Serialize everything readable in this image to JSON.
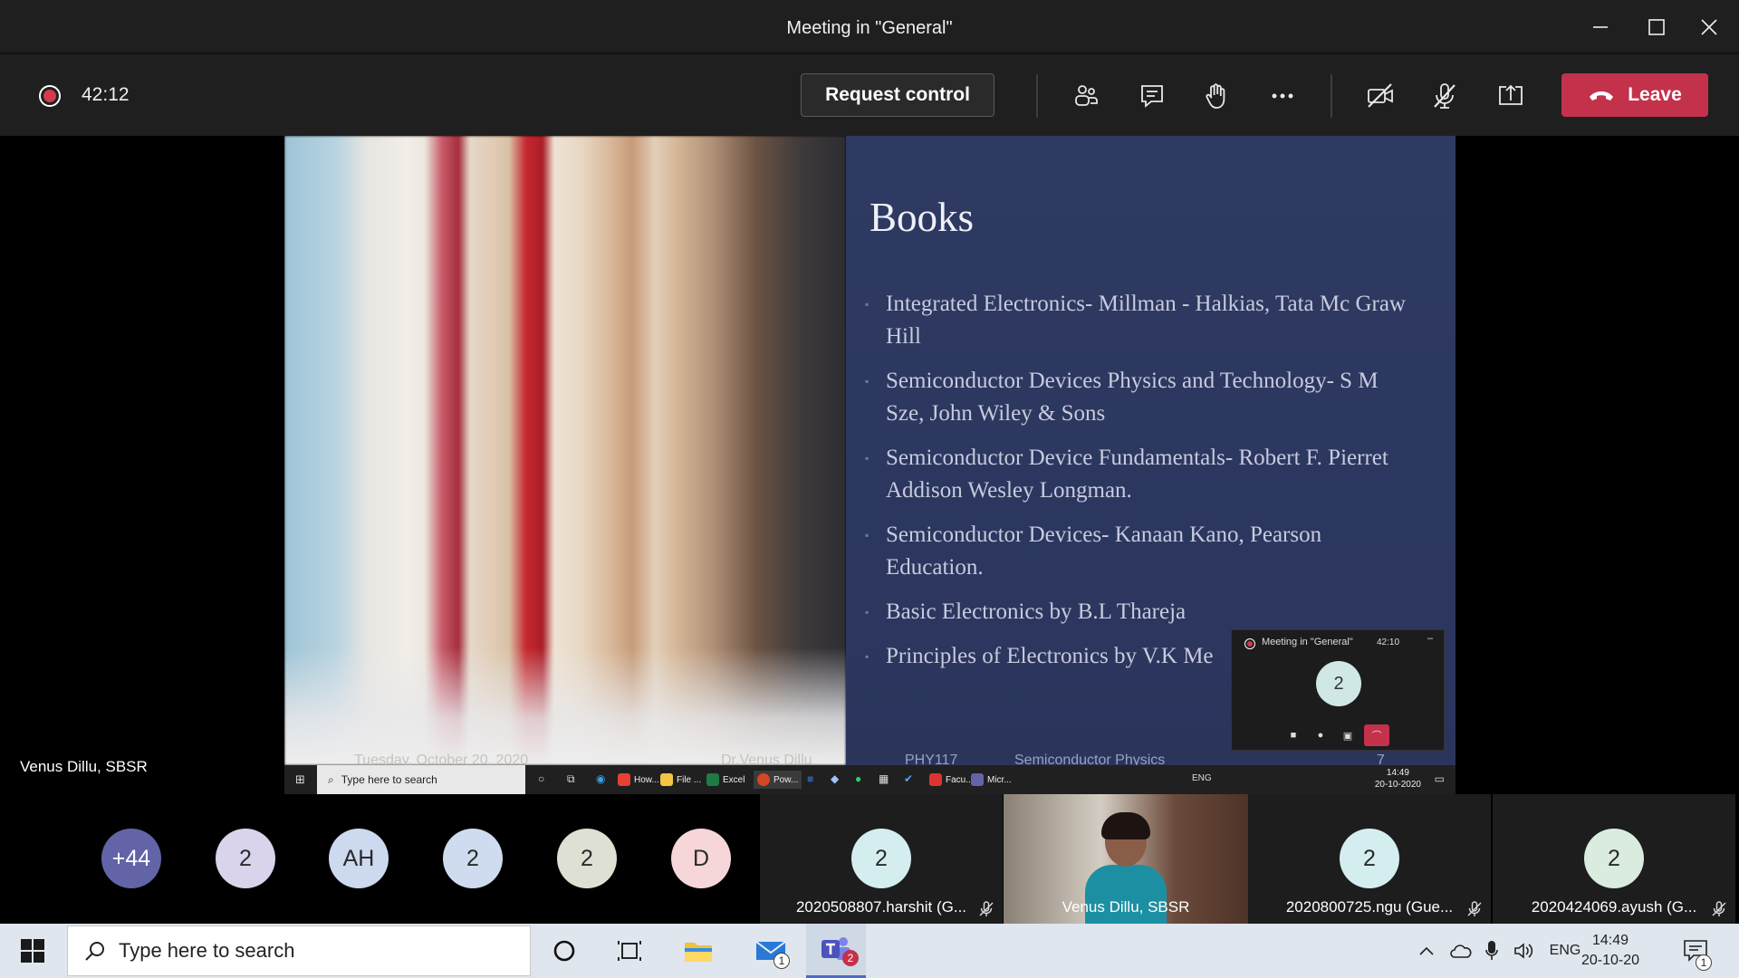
{
  "window": {
    "title": "Meeting in \"General\""
  },
  "controls": {
    "timer": "42:12",
    "request_control_label": "Request control",
    "leave_label": "Leave"
  },
  "slide": {
    "title": "Books",
    "bullets": [
      "Integrated Electronics- Millman - Halkias, Tata Mc Graw Hill",
      "Semiconductor Devices Physics and Technology- S M Sze, John Wiley & Sons",
      "Semiconductor Device Fundamentals- Robert F. Pierret Addison Wesley Longman.",
      "Semiconductor Devices- Kanaan Kano, Pearson Education.",
      "Basic Electronics by B.L Thareja",
      "Principles of Electronics by V.K Me"
    ],
    "footer_date": "Tuesday, October 20, 2020",
    "footer_author": "Dr.Venus Dillu",
    "footer_course": "PHY117",
    "footer_subject": "Semiconductor Physics",
    "footer_page": "7"
  },
  "mini_window": {
    "title": "Meeting in \"General\"",
    "time": "42:10",
    "minimize": "–",
    "avatar": "2"
  },
  "inner_taskbar": {
    "search_placeholder": "Type here to search",
    "apps": [
      "How...",
      "File ...",
      "Excel",
      "Pow...",
      "Facu...",
      "Micr..."
    ],
    "lang": "ENG",
    "time": "14:49",
    "date": "20-10-2020"
  },
  "presenter_name": "Venus Dillu, SBSR",
  "participants": {
    "circles": [
      {
        "initials": "+44",
        "bg": "#6264a7",
        "fg": "#ffffff"
      },
      {
        "initials": "2",
        "bg": "#d9d4ec",
        "fg": "#2a2a2a"
      },
      {
        "initials": "AH",
        "bg": "#cdd9ee",
        "fg": "#2a2a2a"
      },
      {
        "initials": "2",
        "bg": "#cfdcef",
        "fg": "#2a2a2a"
      },
      {
        "initials": "2",
        "bg": "#dde0d2",
        "fg": "#2a2a2a"
      },
      {
        "initials": "D",
        "bg": "#f6d6d8",
        "fg": "#2a2a2a"
      }
    ],
    "tiles": [
      {
        "initials": "2",
        "name": "2020508807.harshit (G...",
        "bg": "#d4eef0"
      },
      {
        "initials": "2",
        "name": "2020800725.ngu (Gue...",
        "bg": "#d4eef0"
      },
      {
        "initials": "2",
        "name": "2020424069.ayush (G...",
        "bg": "#d9ecdf"
      }
    ],
    "video_name": "Venus Dillu, SBSR"
  },
  "taskbar": {
    "search_placeholder": "Type here to search",
    "mail_badge": "1",
    "teams_badge": "2",
    "lang": "ENG",
    "time": "14:49",
    "date": "20-10-20",
    "notification_count": "1"
  },
  "colors": {
    "leave": "#c4314b",
    "record": "#d23b4f",
    "slide_bg": "#2f3a62"
  }
}
